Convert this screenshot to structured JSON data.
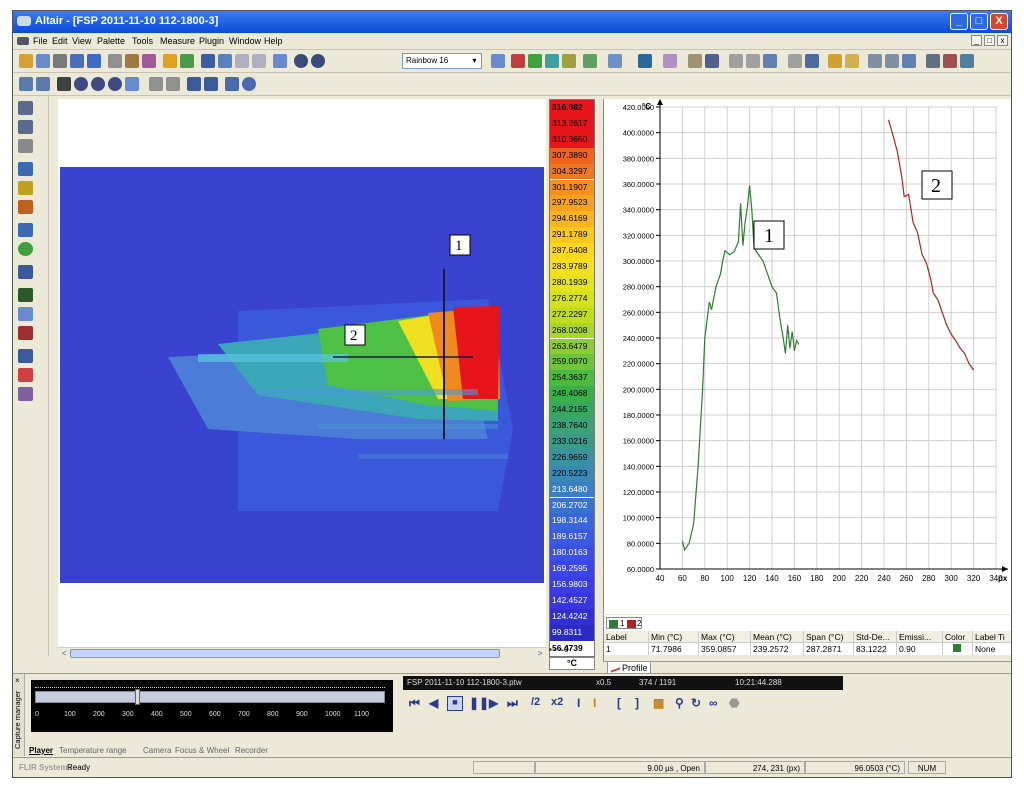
{
  "window": {
    "title": "Altair - [FSP 2011-11-10 112-1800-3]",
    "min_btn": "_",
    "max_btn": "□",
    "close_btn": "X"
  },
  "menu": {
    "items": [
      "File",
      "Edit",
      "View",
      "Palette",
      "Tools",
      "Measure",
      "Plugin",
      "Window",
      "Help"
    ],
    "mdi_min": "_",
    "mdi_restore": "□",
    "mdi_close": "x"
  },
  "toolbar": {
    "palette_value": "Rainbow 16",
    "palette_arrow": "▾"
  },
  "image": {
    "marker1_label": "1",
    "marker2_label": "2",
    "scroll_left": "<",
    "scroll_right": ">"
  },
  "colorbar": {
    "unit": "°C",
    "controls": "▪ ▪ ▪ 0",
    "values": [
      "316.082",
      "313.2617",
      "310.3650",
      "307.3890",
      "304.3297",
      "301.1907",
      "297.9523",
      "294.6169",
      "291.1789",
      "287.6408",
      "283.9789",
      "280.1939",
      "276.2774",
      "272.2297",
      "268.0208",
      "263.6479",
      "259.0970",
      "254.3637",
      "249.4068",
      "244.2155",
      "238.7640",
      "233.0216",
      "226.9659",
      "220.5223",
      "213.6480",
      "206.2702",
      "198.3144",
      "189.6157",
      "180.0163",
      "169.2595",
      "156.9803",
      "142.4527",
      "124.4242",
      "99.8311",
      "56.4739"
    ],
    "colors": [
      "#e8141c",
      "#e8141c",
      "#e8141c",
      "#f0641e",
      "#f0781e",
      "#f5921e",
      "#f7a21e",
      "#f9b41e",
      "#fbc81e",
      "#fcd81e",
      "#f4e01e",
      "#e4e41e",
      "#d2e21e",
      "#c0de1e",
      "#a8d62a",
      "#8cce32",
      "#6ec43a",
      "#4cba40",
      "#3ab048",
      "#38a860",
      "#3aa276",
      "#3a9a8a",
      "#3a92a0",
      "#3a88b4",
      "#3a7ec4",
      "#3a72d2",
      "#3a66dc",
      "#3a5ae2",
      "#3a4fe6",
      "#3a44e8",
      "#3a3ce6",
      "#3a36de",
      "#3030d0",
      "#2a2ac0",
      "#ffffff"
    ]
  },
  "profile": {
    "legend_series": [
      "1",
      "2"
    ],
    "table_headers": [
      "Label",
      "Min (°C)",
      "Max (°C)",
      "Mean (°C)",
      "Span (°C)",
      "Std-De...",
      "Emissi...",
      "Color",
      "Label Ti"
    ],
    "table_row": [
      "1",
      "71.7986",
      "359.0857",
      "239.2572",
      "287.2871",
      "83.1222",
      "0.90",
      "",
      "None"
    ],
    "tab_label": "Profile",
    "annot1": "1",
    "annot2": "2"
  },
  "chart_data": {
    "type": "line",
    "ylabel": "°C",
    "xlabel": "px",
    "xlim": [
      40,
      340
    ],
    "ylim": [
      60,
      420
    ],
    "x_ticks": [
      40,
      60,
      80,
      100,
      120,
      140,
      160,
      180,
      200,
      220,
      240,
      260,
      280,
      300,
      320,
      340
    ],
    "y_ticks": [
      "60.0000",
      "80.0000",
      "100.0000",
      "120.0000",
      "140.0000",
      "160.0000",
      "180.0000",
      "200.0000",
      "220.0000",
      "240.0000",
      "260.0000",
      "280.0000",
      "300.0000",
      "320.0000",
      "340.0000",
      "360.0000",
      "380.0000",
      "400.0000",
      "420.0000"
    ],
    "grid": true,
    "series": [
      {
        "name": "1",
        "color": "#2e7d32",
        "points": [
          [
            60,
            82
          ],
          [
            62,
            75
          ],
          [
            66,
            80
          ],
          [
            70,
            95
          ],
          [
            74,
            140
          ],
          [
            78,
            200
          ],
          [
            80,
            240
          ],
          [
            84,
            268
          ],
          [
            86,
            262
          ],
          [
            90,
            280
          ],
          [
            94,
            290
          ],
          [
            96,
            300
          ],
          [
            98,
            308
          ],
          [
            102,
            305
          ],
          [
            106,
            307
          ],
          [
            110,
            315
          ],
          [
            112,
            345
          ],
          [
            114,
            312
          ],
          [
            116,
            330
          ],
          [
            118,
            342
          ],
          [
            120,
            359
          ],
          [
            122,
            340
          ],
          [
            124,
            310
          ],
          [
            128,
            305
          ],
          [
            132,
            300
          ],
          [
            136,
            290
          ],
          [
            140,
            280
          ],
          [
            144,
            275
          ],
          [
            146,
            262
          ],
          [
            148,
            250
          ],
          [
            150,
            240
          ],
          [
            152,
            228
          ],
          [
            154,
            250
          ],
          [
            156,
            232
          ],
          [
            158,
            245
          ],
          [
            160,
            230
          ],
          [
            162,
            238
          ],
          [
            164,
            235
          ]
        ]
      },
      {
        "name": "2",
        "color": "#b22222",
        "points": [
          [
            244,
            410
          ],
          [
            248,
            398
          ],
          [
            252,
            385
          ],
          [
            256,
            365
          ],
          [
            258,
            350
          ],
          [
            262,
            352
          ],
          [
            266,
            330
          ],
          [
            270,
            322
          ],
          [
            274,
            305
          ],
          [
            278,
            298
          ],
          [
            282,
            285
          ],
          [
            284,
            275
          ],
          [
            288,
            270
          ],
          [
            292,
            260
          ],
          [
            296,
            250
          ],
          [
            300,
            243
          ],
          [
            304,
            238
          ],
          [
            308,
            232
          ],
          [
            312,
            228
          ],
          [
            316,
            220
          ],
          [
            320,
            215
          ]
        ]
      }
    ]
  },
  "player": {
    "file": "FSP 2011-11-10 112-1800-3.ptw",
    "speed": "x0.5",
    "frame": "374 / 1191",
    "time": "10:21:44.288",
    "div2": "/2",
    "x2": "x2",
    "timeline_labels": [
      "0",
      "100",
      "200",
      "300",
      "400",
      "500",
      "600",
      "700",
      "800",
      "900",
      "1000",
      "1100"
    ]
  },
  "bottom_tabs": {
    "dock_label": "Capture manager",
    "tabs": [
      "Player",
      "Temperature range",
      "Camera",
      "Focus & Wheel",
      "Recorder"
    ]
  },
  "status": {
    "brand": "FLIR Systems",
    "state": "Ready",
    "integration": "9.00 µs , Open",
    "coords": "274, 231 (px)",
    "temp": "96.0503 (°C)",
    "num": "NUM"
  }
}
